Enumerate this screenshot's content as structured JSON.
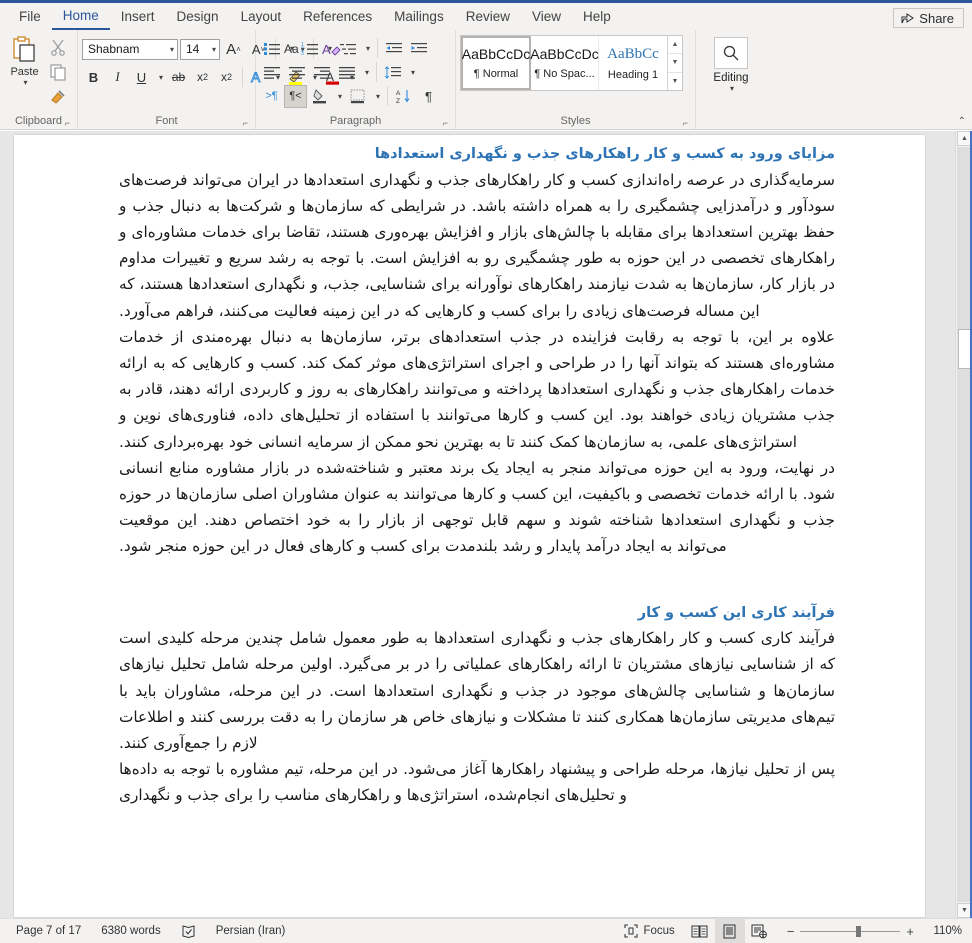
{
  "titlebar": {
    "tabs": [
      {
        "label": "File",
        "active": false
      },
      {
        "label": "Home",
        "active": true
      },
      {
        "label": "Insert",
        "active": false
      },
      {
        "label": "Design",
        "active": false
      },
      {
        "label": "Layout",
        "active": false
      },
      {
        "label": "References",
        "active": false
      },
      {
        "label": "Mailings",
        "active": false
      },
      {
        "label": "Review",
        "active": false
      },
      {
        "label": "View",
        "active": false
      },
      {
        "label": "Help",
        "active": false
      }
    ],
    "share_label": "Share",
    "accent_color": "#2b579a"
  },
  "ribbon": {
    "clipboard": {
      "group_label": "Clipboard",
      "paste_label": "Paste",
      "cut_icon": "scissors-icon",
      "copy_icon": "copy-icon",
      "format_painter_icon": "paintbrush-icon",
      "dialog_launcher": "⌐"
    },
    "font": {
      "group_label": "Font",
      "font_name": "Shabnam",
      "font_size": "14",
      "grow_font": "A",
      "shrink_font": "A",
      "change_case": "Aa",
      "clear_formatting": "A",
      "bold": "B",
      "italic": "I",
      "underline": "U",
      "strikethrough": "ab",
      "subscript": "x",
      "superscript": "x",
      "text_effects": "A",
      "highlight": "A",
      "font_color": "A",
      "dialog_launcher": "⌐"
    },
    "paragraph": {
      "group_label": "Paragraph",
      "bullets": "bullets-icon",
      "numbering": "numbering-icon",
      "multilevel": "multilevel-list-icon",
      "decrease_indent": "decrease-indent-icon",
      "increase_indent": "increase-indent-icon",
      "align_left": "align-left-icon",
      "align_center": "align-center-icon",
      "align_right": "align-right-icon",
      "justify": "justify-icon",
      "line_spacing": "line-spacing-icon",
      "ltr_text": ">¶",
      "rtl_text": "¶<",
      "shading": "shading-icon",
      "borders": "borders-icon",
      "sort": "sort-icon",
      "show_marks": "¶",
      "dialog_launcher": "⌐"
    },
    "styles": {
      "group_label": "Styles",
      "items": [
        {
          "preview": "AaBbCcDc",
          "name": "¶ Normal",
          "selected": true,
          "heading": false
        },
        {
          "preview": "AaBbCcDc",
          "name": "¶ No Spac...",
          "selected": false,
          "heading": false
        },
        {
          "preview": "AaBbCc",
          "name": "Heading 1",
          "selected": false,
          "heading": true
        }
      ],
      "dialog_launcher": "⌐"
    },
    "editing": {
      "group_label": "Editing",
      "label": "Editing",
      "icon": "search-icon"
    },
    "collapse_ribbon": "^"
  },
  "document": {
    "blocks": [
      {
        "type": "heading",
        "text": "مزایای ورود به کسب و کار راهکارهای جذب و نگهداری استعدادها"
      },
      {
        "type": "paragraph",
        "text": "سرمایه‌گذاری در عرصه راه‌اندازی کسب و کار راهکارهای جذب و نگهداری استعدادها در ایران می‌تواند فرصت‌های سودآور و درآمدزایی چشمگیری را به همراه داشته باشد. در شرایطی که سازمان‌ها و شرکت‌ها به دنبال جذب و حفظ بهترین استعدادها برای مقابله با چالش‌های بازار و افزایش بهره‌وری هستند، تقاضا برای خدمات مشاوره‌ای و راهکارهای تخصصی در این حوزه به طور چشمگیری رو به افزایش است. با توجه به رشد سریع و تغییرات مداوم در بازار کار، سازمان‌ها به شدت نیازمند راهکارهای نوآورانه برای شناسایی، جذب، و نگهداری استعدادها هستند، که این مساله فرصت‌های زیادی را برای کسب و کارهایی که در این زمینه فعالیت می‌کنند، فراهم می‌آورد."
      },
      {
        "type": "paragraph",
        "text": "علاوه بر این، با توجه به رقابت فزاینده در جذب استعدادهای برتر، سازمان‌ها به دنبال بهره‌مندی از خدمات مشاوره‌ای هستند که بتواند آنها را در طراحی و اجرای استراتژی‌های موثر کمک کند. کسب و کارهایی که به ارائه خدمات راهکارهای جذب و نگهداری استعدادها پرداخته و می‌توانند راهکارهای به روز و کاربردی ارائه دهند، قادر به جذب مشتریان زیادی خواهند بود. این کسب و کارها می‌توانند با استفاده از تحلیل‌های داده، فناوری‌های نوین و استراتژی‌های علمی، به سازمان‌ها کمک کنند تا به بهترین نحو ممکن از سرمایه انسانی خود بهره‌برداری کنند."
      },
      {
        "type": "paragraph",
        "text": "در نهایت، ورود به این حوزه می‌تواند منجر به ایجاد یک برند معتبر و شناخته‌شده در بازار مشاوره منابع انسانی شود. با ارائه خدمات تخصصی و باکیفیت، این کسب و کارها می‌توانند به عنوان مشاوران اصلی سازمان‌ها در حوزه جذب و نگهداری استعدادها شناخته شوند و سهم قابل توجهی از بازار را به خود اختصاص دهند. این موقعیت می‌تواند به ایجاد درآمد پایدار و رشد بلندمدت برای کسب و کارهای فعال در این حوزه منجر شود."
      },
      {
        "type": "heading2",
        "text": "فرآیند کاری این کسب و کار"
      },
      {
        "type": "paragraph",
        "text": "فرآیند کاری کسب و کار راهکارهای جذب و نگهداری استعدادها به طور معمول شامل چندین مرحله کلیدی است که از شناسایی نیازهای مشتریان تا ارائه راهکارهای عملیاتی را در بر می‌گیرد. اولین مرحله شامل تحلیل نیازهای سازمان‌ها و شناسایی چالش‌های موجود در جذب و نگهداری استعدادها است. در این مرحله، مشاوران باید با تیم‌های مدیریتی سازمان‌ها همکاری کنند تا مشکلات و نیازهای خاص هر سازمان را به دقت بررسی کنند و اطلاعات لازم را جمع‌آوری کنند."
      },
      {
        "type": "paragraph",
        "text": "پس از تحلیل نیازها، مرحله طراحی و پیشنهاد راهکارها آغاز می‌شود. در این مرحله، تیم مشاوره با توجه به داده‌ها و تحلیل‌های انجام‌شده، استراتژی‌ها و راهکارهای مناسب را برای جذب و نگهداری"
      }
    ],
    "heading_color": "#2e74b5",
    "body_color": "#1a1a1a"
  },
  "statusbar": {
    "page_info": "Page 7 of 17",
    "word_count": "6380 words",
    "proofing_icon": "proofing-errors-icon",
    "language": "Persian (Iran)",
    "focus_label": "Focus",
    "focus_icon": "focus-icon",
    "view_read_icon": "read-mode-icon",
    "view_print_icon": "print-layout-icon",
    "view_web_icon": "web-layout-icon",
    "zoom_out": "−",
    "zoom_in": "+",
    "zoom_level": "110%"
  }
}
